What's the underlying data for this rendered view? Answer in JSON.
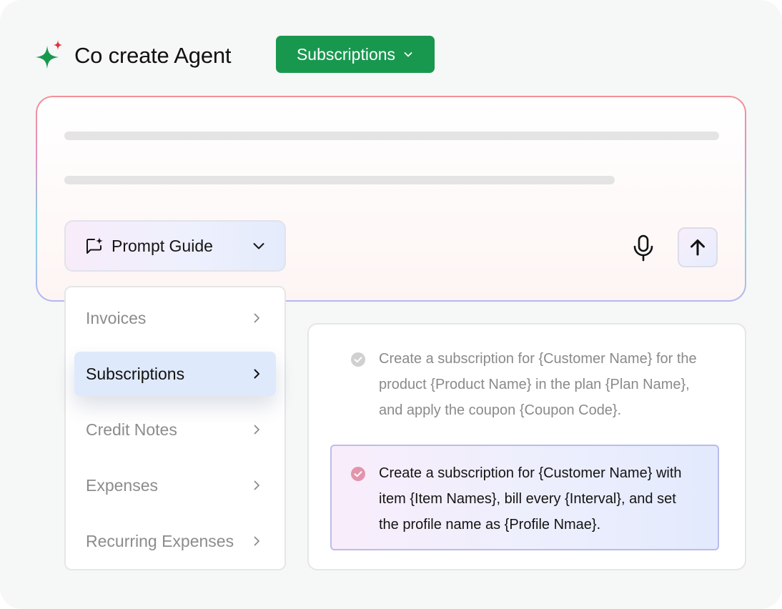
{
  "header": {
    "title": "Co create Agent",
    "module_button": {
      "label": "Subscriptions",
      "icon": "chevron-down-icon"
    },
    "logo_icon": "sparkle-icon",
    "logo_colors": {
      "main": "#18984f",
      "accent": "#e0323c"
    }
  },
  "prompt_box": {
    "input_lines": 2,
    "prompt_guide": {
      "label": "Prompt Guide",
      "icon": "chat-sparkle-icon",
      "chevron": "chevron-down-icon"
    },
    "actions": [
      {
        "name": "microphone",
        "icon": "microphone-icon"
      },
      {
        "name": "send",
        "icon": "arrow-up-icon"
      }
    ]
  },
  "menu": {
    "items": [
      {
        "label": "Invoices",
        "active": false
      },
      {
        "label": "Subscriptions",
        "active": true
      },
      {
        "label": "Credit Notes",
        "active": false
      },
      {
        "label": "Expenses",
        "active": false
      },
      {
        "label": "Recurring Expenses",
        "active": false
      }
    ]
  },
  "suggestions": [
    {
      "text": "Create a subscription for {Customer Name} for the product {Product Name} in the plan {Plan Name}, and apply the coupon {Coupon Code}.",
      "selected": false,
      "check_color": "#d0d0d0"
    },
    {
      "text": "Create a subscription for {Customer Name} with item  {Item Names}, bill every {Interval}, and set the profile name as {Profile Nmae}.",
      "selected": true,
      "check_color": "#e394ad"
    }
  ],
  "colors": {
    "brand_green": "#18984f",
    "active_menu_bg": "#dfe9fc",
    "selected_border": "#bbbcec"
  }
}
